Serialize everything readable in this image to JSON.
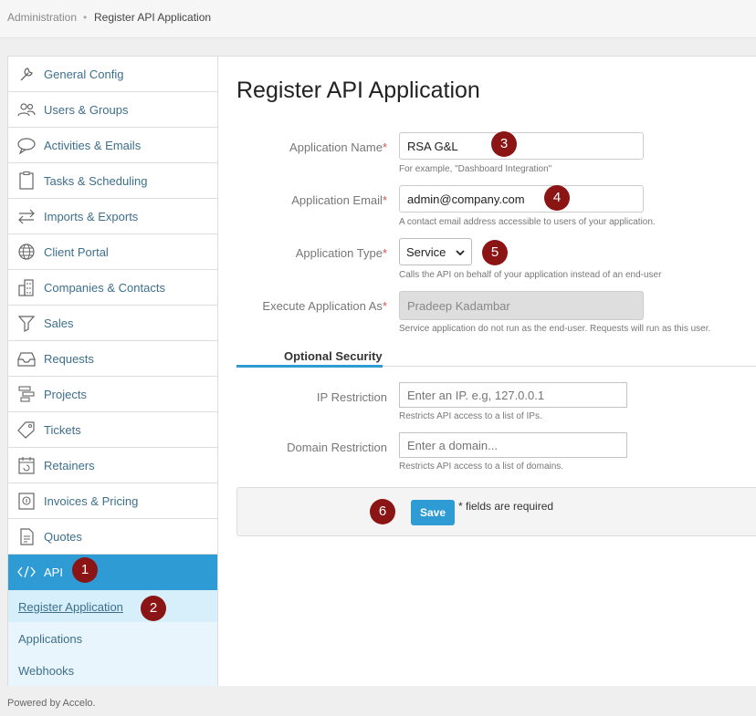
{
  "breadcrumb": {
    "root": "Administration",
    "separator": "•",
    "current": "Register API Application"
  },
  "sidebar": {
    "items": [
      {
        "label": "General Config",
        "icon": "wrench-icon"
      },
      {
        "label": "Users & Groups",
        "icon": "users-icon"
      },
      {
        "label": "Activities & Emails",
        "icon": "chat-icon"
      },
      {
        "label": "Tasks & Scheduling",
        "icon": "clipboard-icon"
      },
      {
        "label": "Imports & Exports",
        "icon": "swap-arrows-icon"
      },
      {
        "label": "Client Portal",
        "icon": "globe-icon"
      },
      {
        "label": "Companies & Contacts",
        "icon": "building-icon"
      },
      {
        "label": "Sales",
        "icon": "funnel-icon"
      },
      {
        "label": "Requests",
        "icon": "inbox-icon"
      },
      {
        "label": "Projects",
        "icon": "gantt-icon"
      },
      {
        "label": "Tickets",
        "icon": "ticket-icon"
      },
      {
        "label": "Retainers",
        "icon": "calendar-refresh-icon"
      },
      {
        "label": "Invoices & Pricing",
        "icon": "invoice-icon"
      },
      {
        "label": "Quotes",
        "icon": "quote-icon"
      },
      {
        "label": "API",
        "icon": "code-icon"
      }
    ],
    "api_sub": [
      "Register Application",
      "Applications",
      "Webhooks"
    ]
  },
  "page": {
    "title": "Register API Application"
  },
  "form": {
    "required_mark": "*",
    "app_name": {
      "label": "Application Name",
      "value": "RSA G&L",
      "help": "For example, \"Dashboard Integration\""
    },
    "app_email": {
      "label": "Application Email",
      "value": "admin@company.com",
      "help": "A contact email address accessible to users of your application."
    },
    "app_type": {
      "label": "Application Type",
      "value": "Service",
      "help": "Calls the API on behalf of your application instead of an end-user"
    },
    "execute_as": {
      "label": "Execute Application As",
      "value": "Pradeep Kadambar",
      "help": "Service application do not run as the end-user. Requests will run as this user."
    },
    "optional_security": "Optional Security",
    "ip": {
      "label": "IP Restriction",
      "placeholder": "Enter an IP. e.g, 127.0.0.1",
      "help": "Restricts API access to a list of IPs."
    },
    "domain": {
      "label": "Domain Restriction",
      "placeholder": "Enter a domain...",
      "help": "Restricts API access to a list of domains."
    },
    "save_label": "Save",
    "required_note": "* fields are required"
  },
  "markers": [
    "1",
    "2",
    "3",
    "4",
    "5",
    "6"
  ],
  "footer": "Powered by Accelo.",
  "colors": {
    "accent": "#2f9bd5",
    "marker": "#8b1414",
    "link": "#3d6f8c"
  }
}
